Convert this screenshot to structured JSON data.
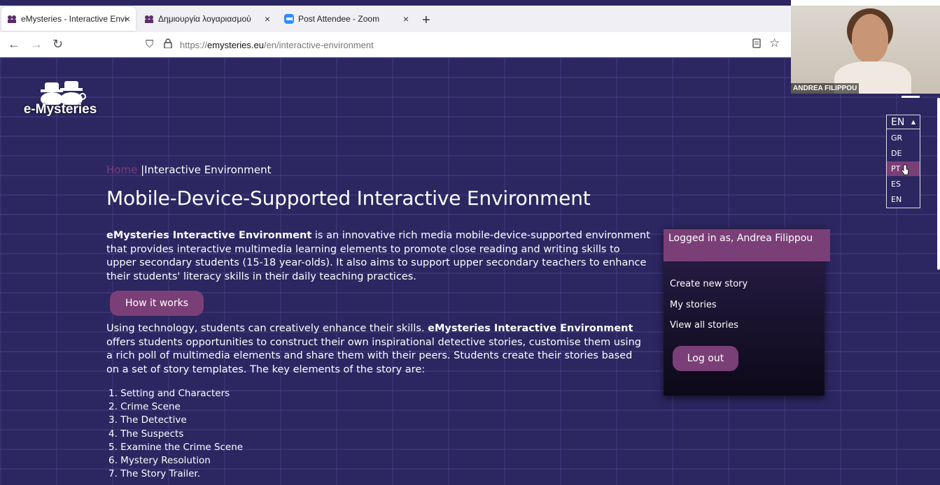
{
  "browser": {
    "tabs": [
      {
        "label": "eMysteries - Interactive Environ",
        "icon": "emysteries-favicon"
      },
      {
        "label": "Δημιουργία λογαριασμού",
        "icon": "emysteries-favicon"
      },
      {
        "label": "Post Attendee - Zoom",
        "icon": "zoom-favicon"
      }
    ],
    "new_tab": "+",
    "close": "×",
    "url_prefix": "https://",
    "url_host": "emysteries.eu",
    "url_path": "/en/interactive-environment"
  },
  "video": {
    "name": "ANDREA FILIPPOU"
  },
  "logo": {
    "text": "e-Mysteries"
  },
  "breadcrumb": {
    "home": "Home",
    "separator": "|",
    "current": "Interactive Environment"
  },
  "title": "Mobile-Device-Supported Interactive Environment",
  "intro": {
    "bold": "eMysteries Interactive Environment",
    "text": " is an innovative rich media mobile-device-supported environment that provides interactive multimedia learning elements to promote close reading and writing skills to upper secondary students (15-18 year-olds). It also aims to support upper secondary teachers to enhance their students' literacy skills in their daily teaching practices."
  },
  "how_it_works": "How it works",
  "second": {
    "text_before": "Using technology, students can creatively enhance their skills. ",
    "bold": "eMysteries Interactive Environment",
    "text_after": " offers students opportunities to construct their own inspirational detective stories, customise them using a rich poll of multimedia elements and share them with their peers. Students create their stories based on a set of story templates. The key elements of the story are:"
  },
  "steps": [
    "1. Setting and Characters",
    "2. Crime Scene",
    "3. The Detective",
    "4. The Suspects",
    "5. Examine the Crime Scene",
    "6. Mystery Resolution",
    "7. The Story Trailer."
  ],
  "panel": {
    "logged_in": "Logged in as, Andrea Filippou",
    "create": "Create new story",
    "my": "My stories",
    "all": "View all stories",
    "logout": "Log out"
  },
  "lang": {
    "current": "EN",
    "options": [
      "GR",
      "DE",
      "PT",
      "ES",
      "EN"
    ],
    "highlighted": "PT"
  }
}
